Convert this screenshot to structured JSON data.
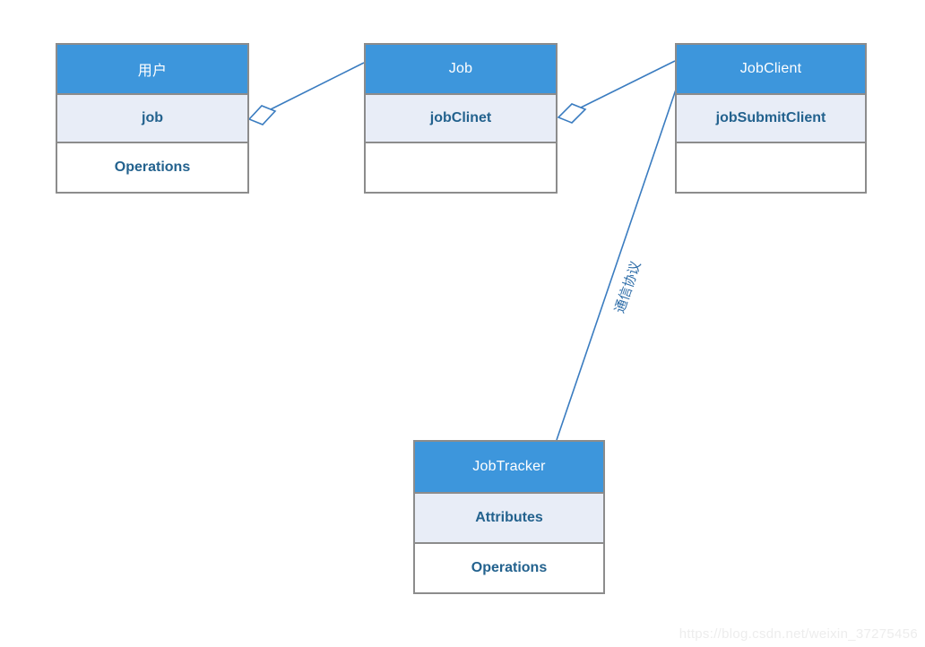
{
  "diagram": {
    "type": "uml-class-diagram",
    "title": "",
    "colors": {
      "header_fill": "#3d96dc",
      "header_text": "#ffffff",
      "attribute_fill": "#e8edf7",
      "operation_fill": "#ffffff",
      "body_text": "#23628e",
      "box_border": "#8c8c8c",
      "connector": "#3a7cc0",
      "watermark_text": "#ededed",
      "background": "#ffffff"
    },
    "classes": [
      {
        "id": "user",
        "name": "用户",
        "attributes": "job",
        "operations": "Operations"
      },
      {
        "id": "job",
        "name": "Job",
        "attributes": "jobClinet",
        "operations": ""
      },
      {
        "id": "jobclient",
        "name": "JobClient",
        "attributes": "jobSubmitClient",
        "operations": ""
      },
      {
        "id": "jobtracker",
        "name": "JobTracker",
        "attributes": "Attributes",
        "operations": "Operations"
      }
    ],
    "connections": [
      {
        "id": "user-job",
        "from": "job",
        "to": "user",
        "kind": "aggregation",
        "label": ""
      },
      {
        "id": "job-jobclient",
        "from": "jobclient",
        "to": "job",
        "kind": "aggregation",
        "label": ""
      },
      {
        "id": "jobclient-jobtracker",
        "from": "jobclient",
        "to": "jobtracker",
        "kind": "association",
        "label": "通信协议"
      }
    ]
  },
  "watermark": {
    "text": "https://blog.csdn.net/weixin_37275456"
  }
}
